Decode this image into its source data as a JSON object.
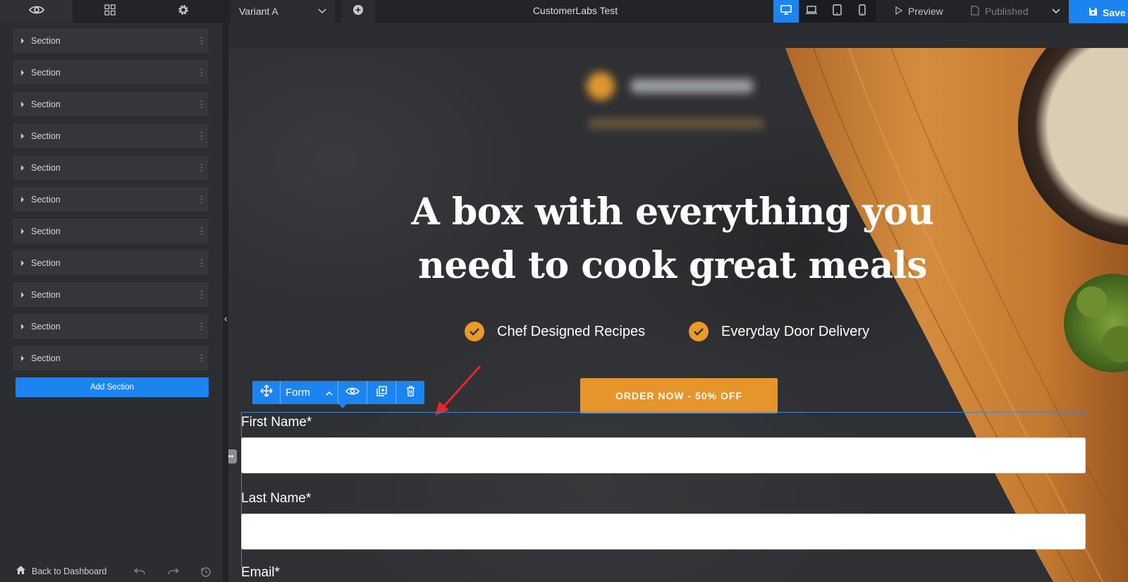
{
  "topbar": {
    "variant_label": "Variant A",
    "page_title": "CustomerLabs Test",
    "preview_label": "Preview",
    "published_label": "Published",
    "save_label": "Save",
    "active_device": "desktop",
    "accent_color": "#1c84f1"
  },
  "sidebar": {
    "sections": [
      {
        "label": "Section"
      },
      {
        "label": "Section"
      },
      {
        "label": "Section"
      },
      {
        "label": "Section"
      },
      {
        "label": "Section"
      },
      {
        "label": "Section"
      },
      {
        "label": "Section"
      },
      {
        "label": "Section"
      },
      {
        "label": "Section"
      },
      {
        "label": "Section"
      },
      {
        "label": "Section"
      }
    ],
    "add_section_label": "Add Section",
    "back_label": "Back to Dashboard"
  },
  "hero": {
    "headline_line1": "A box with everything you",
    "headline_line2": "need to cook great meals",
    "features": [
      {
        "label": "Chef Designed Recipes"
      },
      {
        "label": "Everyday Door Delivery"
      }
    ],
    "cta_label": "ORDER NOW - 50% OFF",
    "accent_color": "#e6952b"
  },
  "form": {
    "toolbar_label": "Form",
    "fields": [
      {
        "label": "First Name*",
        "value": ""
      },
      {
        "label": "Last Name*",
        "value": ""
      }
    ],
    "next_label_partial": "Email*"
  }
}
